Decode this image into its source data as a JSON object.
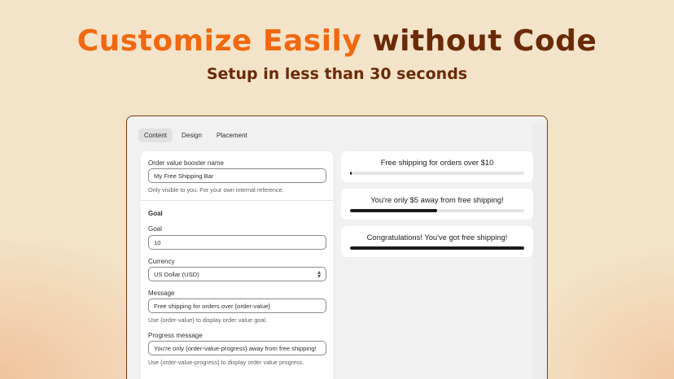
{
  "hero": {
    "title_accent": "Customize Easily",
    "title_rest": "without Code",
    "subtitle": "Setup in less than 30 seconds"
  },
  "colors": {
    "accent": "#f0680f",
    "dark": "#6b2a07",
    "background": "#f3e3c8"
  },
  "tabs": [
    {
      "label": "Content",
      "active": true
    },
    {
      "label": "Design",
      "active": false
    },
    {
      "label": "Placement",
      "active": false
    }
  ],
  "form": {
    "name_label": "Order value booster name",
    "name_value": "My Free Shipping Bar",
    "name_help": "Only visible to you. For your own internal reference.",
    "goal_section": "Goal",
    "goal_label": "Goal",
    "goal_value": "10",
    "currency_label": "Currency",
    "currency_value": "US Dollar (USD)",
    "currency_icon": "select-arrows-icon",
    "message_label": "Message",
    "message_value": "Free shipping for orders over {order-value}",
    "message_help": "Use {order-value} to display order value goal.",
    "progress_label": "Progress message",
    "progress_value": "You're only {order-value-progress} away from free shipping!",
    "progress_help": "Use {order-value-progress} to display order value progress."
  },
  "previews": [
    {
      "message": "Free shipping for orders over $10",
      "progress": 0.01
    },
    {
      "message": "You're only $5 away from free shipping!",
      "progress": 0.5
    },
    {
      "message": "Congratulations! You've got free shipping!",
      "progress": 1.0
    }
  ]
}
